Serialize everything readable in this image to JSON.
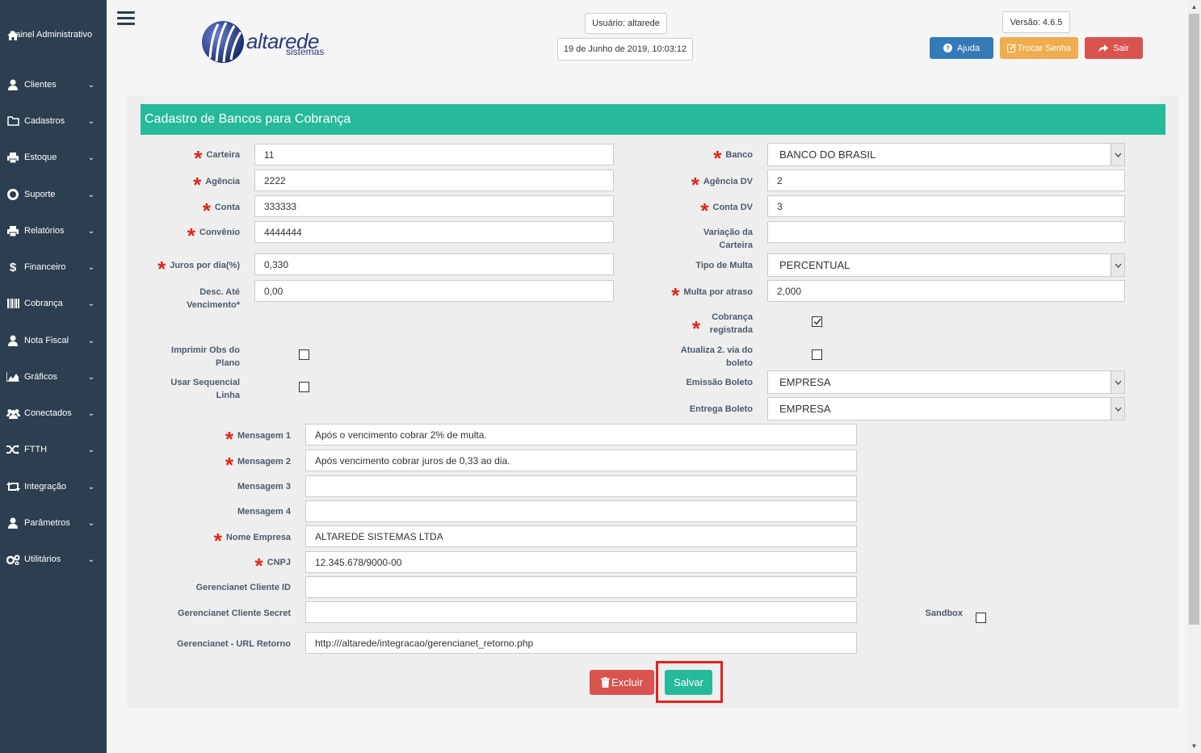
{
  "sidebar": {
    "items": [
      {
        "label": "Painel Administrativo",
        "icon": "home-icon"
      },
      {
        "label": "Clientes",
        "icon": "user-icon"
      },
      {
        "label": "Cadastros",
        "icon": "folder-icon"
      },
      {
        "label": "Estoque",
        "icon": "printer-icon"
      },
      {
        "label": "Suporte",
        "icon": "lifebuoy-icon"
      },
      {
        "label": "Relatórios",
        "icon": "printer-icon"
      },
      {
        "label": "Financeiro",
        "icon": "dollar-icon"
      },
      {
        "label": "Cobrança",
        "icon": "barcode-icon"
      },
      {
        "label": "Nota Fiscal",
        "icon": "user-icon"
      },
      {
        "label": "Gráficos",
        "icon": "area-chart-icon"
      },
      {
        "label": "Conectados",
        "icon": "users-icon"
      },
      {
        "label": "FTTH",
        "icon": "random-icon"
      },
      {
        "label": "Integração",
        "icon": "retweet-icon"
      },
      {
        "label": "Parâmetros",
        "icon": "user-icon"
      },
      {
        "label": "Utilitários",
        "icon": "cogs-icon"
      }
    ]
  },
  "header": {
    "logo_text": "altarede",
    "logo_sub": "sistemas",
    "user": "Usuário: altarede",
    "datetime": "19 de Junho de 2019, 10:03:12",
    "version": "Versão: 4.6.5",
    "help_label": "Ajuda",
    "change_password_label": "Trocar Senha",
    "logout_label": "Sair",
    "colors": {
      "help": "#337ab7",
      "change_password": "#f0ad4e",
      "logout": "#d9534f"
    }
  },
  "form": {
    "title": "Cadastro de Bancos para Cobrança",
    "left": {
      "carteira": {
        "label": "Carteira",
        "value": "11"
      },
      "agencia": {
        "label": "Agência",
        "value": "2222"
      },
      "conta": {
        "label": "Conta",
        "value": "333333"
      },
      "convenio": {
        "label": "Convênio",
        "value": "4444444"
      },
      "juros": {
        "label": "Juros por dia(%)",
        "value": "0,330"
      },
      "desconto": {
        "label": "Desc. Até Vencimento*",
        "value": "0,00"
      },
      "imprimir_obs": {
        "label": "Imprimir Obs do Plano",
        "checked": false
      },
      "usar_sequencial": {
        "label": "Usar Sequencial Linha",
        "checked": false
      }
    },
    "right": {
      "banco": {
        "label": "Banco",
        "value": "BANCO DO BRASIL"
      },
      "agencia_dv": {
        "label": "Agência DV",
        "value": "2"
      },
      "conta_dv": {
        "label": "Conta DV",
        "value": "3"
      },
      "variacao": {
        "label": "Variação da Carteira",
        "value": ""
      },
      "tipo_multa": {
        "label": "Tipo de Multa",
        "value": "PERCENTUAL"
      },
      "multa": {
        "label": "Multa por atraso",
        "value": "2,000"
      },
      "cobranca_registrada": {
        "label": "Cobrança registrada",
        "checked": true
      },
      "atualiza_via": {
        "label": "Atualiza 2. via do boleto",
        "checked": false
      },
      "emissao": {
        "label": "Emissão Boleto",
        "value": "EMPRESA"
      },
      "entrega": {
        "label": "Entrega Boleto",
        "value": "EMPRESA"
      }
    },
    "bottom": {
      "mensagem1": {
        "label": "Mensagem 1",
        "value": "Após o vencimento cobrar 2% de multa."
      },
      "mensagem2": {
        "label": "Mensagem 2",
        "value": "Após vencimento cobrar juros de 0,33 ao dia."
      },
      "mensagem3": {
        "label": "Mensagem 3",
        "value": ""
      },
      "mensagem4": {
        "label": "Mensagem 4",
        "value": ""
      },
      "nome_empresa": {
        "label": "Nome Empresa",
        "value": "ALTAREDE SISTEMAS LTDA"
      },
      "cnpj": {
        "label": "CNPJ",
        "value": "12.345.678/9000-00"
      },
      "gn_client_id": {
        "label": "Gerencianet Cliente ID",
        "value": ""
      },
      "gn_client_secret": {
        "label": "Gerencianet Cliente Secret",
        "value": ""
      },
      "sandbox": {
        "label": "Sandbox",
        "checked": false
      },
      "gn_url": {
        "label": "Gerencianet - URL Retorno",
        "value": "http:///altarede/integracao/gerencianet_retorno.php"
      }
    },
    "delete_label": "Excluir",
    "save_label": "Salvar",
    "accent": "#26b99a"
  }
}
